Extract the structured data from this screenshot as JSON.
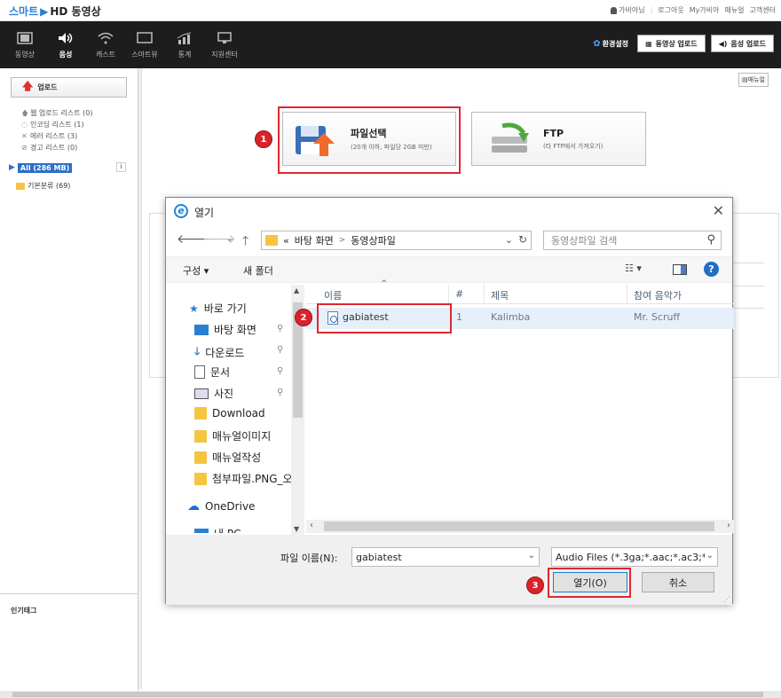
{
  "topbar": {
    "logo_smart": "스마트",
    "logo_rest": "HD 동영상",
    "user": "가비아님",
    "links": [
      "로그아웃",
      "My가비아",
      "매뉴얼",
      "고객센터"
    ]
  },
  "nav": {
    "items": [
      "동영상",
      "음성",
      "캐스트",
      "스마트뷰",
      "통계",
      "지원센터"
    ],
    "env_settings": "환경설정",
    "video_upload": "동영상 업로드",
    "audio_upload": "음성 업로드"
  },
  "sidebar": {
    "upload_button": "업로드",
    "lists": [
      "웹 업로드 리스트 (0)",
      "인코딩 리스트 (1)",
      "에러 리스트 (3)",
      "경고 리스트 (0)"
    ],
    "all_label": "All (286 MB)",
    "info": "i",
    "folder": "기본분류 (69)",
    "tags_title": "인기태그"
  },
  "main": {
    "manual": "매뉴얼",
    "card_file_title": "파일선택",
    "card_file_sub": "(20개 이하, 파일당 2GB 미만)",
    "card_ftp_title": "FTP",
    "card_ftp_sub": "(타 FTP에서 가져오기)",
    "step1": "1",
    "step2": "2",
    "step3": "3"
  },
  "dialog": {
    "title": "열기",
    "path_prefix": "«",
    "path": [
      "바탕 화면",
      "동영상파일"
    ],
    "search_placeholder": "동영상파일 검색",
    "organize": "구성 ▾",
    "new_folder": "새 폴더",
    "help": "?",
    "nav_items": [
      "바로 가기",
      "바탕 화면",
      "다운로드",
      "문서",
      "사진",
      "Download",
      "매뉴얼이미지",
      "매뉴얼작성",
      "첨부파일.PNG_오",
      "OneDrive",
      "내 PC"
    ],
    "columns": [
      "이름",
      "#",
      "제목",
      "참여 음악가"
    ],
    "file": {
      "name": "gabiatest",
      "num": "1",
      "title": "Kalimba",
      "artist": "Mr. Scruff"
    },
    "filename_label": "파일 이름(N):",
    "filename_value": "gabiatest",
    "filetype_value": "Audio Files (*.3ga;*.aac;*.ac3;*.",
    "open_button": "열기(O)",
    "cancel_button": "취소"
  }
}
